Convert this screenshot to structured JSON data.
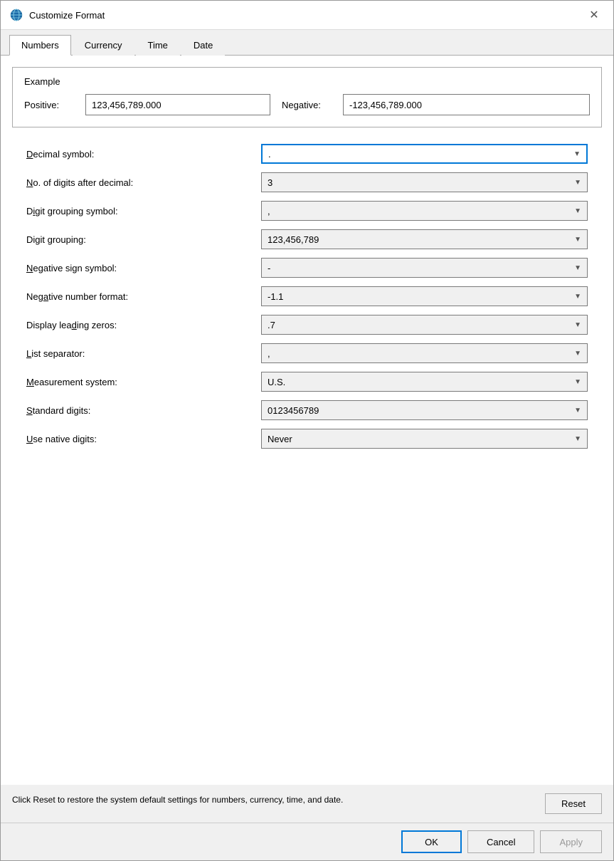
{
  "dialog": {
    "title": "Customize Format",
    "icon": "globe-icon"
  },
  "tabs": [
    {
      "id": "numbers",
      "label": "Numbers",
      "active": true
    },
    {
      "id": "currency",
      "label": "Currency",
      "active": false
    },
    {
      "id": "time",
      "label": "Time",
      "active": false
    },
    {
      "id": "date",
      "label": "Date",
      "active": false
    }
  ],
  "example": {
    "title": "Example",
    "positive_label": "Positive:",
    "positive_value": "123,456,789.000",
    "negative_label": "Negative:",
    "negative_value": "-123,456,789.000"
  },
  "settings": [
    {
      "id": "decimal-symbol",
      "label_html": "<u>D</u>ecimal symbol:",
      "label_text": "Decimal symbol:",
      "value": ".",
      "active": true
    },
    {
      "id": "digits-after-decimal",
      "label_html": "<u>N</u>o. of digits after decimal:",
      "label_text": "No. of digits after decimal:",
      "value": "3",
      "active": false
    },
    {
      "id": "digit-grouping-symbol",
      "label_html": "D<u>i</u>git grouping symbol:",
      "label_text": "Digit grouping symbol:",
      "value": ",",
      "active": false
    },
    {
      "id": "digit-grouping",
      "label_html": "Di<u>g</u>it grouping:",
      "label_text": "Digit grouping:",
      "value": "123,456,789",
      "active": false
    },
    {
      "id": "negative-sign-symbol",
      "label_html": "<u>N</u>egative sign symbol:",
      "label_text": "Negative sign symbol:",
      "value": "-",
      "active": false
    },
    {
      "id": "negative-number-format",
      "label_html": "Neg<u>a</u>tive number format:",
      "label_text": "Negative number format:",
      "value": "-1.1",
      "active": false
    },
    {
      "id": "display-leading-zeros",
      "label_html": "Display lea<u>d</u>ing zeros:",
      "label_text": "Display leading zeros:",
      "value": ".7",
      "active": false
    },
    {
      "id": "list-separator",
      "label_html": "<u>L</u>ist separator:",
      "label_text": "List separator:",
      "value": ",",
      "active": false
    },
    {
      "id": "measurement-system",
      "label_html": "<u>M</u>easurement system:",
      "label_text": "Measurement system:",
      "value": "U.S.",
      "active": false
    },
    {
      "id": "standard-digits",
      "label_html": "<u>S</u>tandard digits:",
      "label_text": "Standard digits:",
      "value": "0123456789",
      "active": false
    },
    {
      "id": "use-native-digits",
      "label_html": "<u>U</u>se native digits:",
      "label_text": "Use native digits:",
      "value": "Never",
      "active": false
    }
  ],
  "footer": {
    "text": "Click Reset to restore the system default settings for numbers, currency, time, and date.",
    "reset_label": "Reset"
  },
  "buttons": {
    "ok": "OK",
    "cancel": "Cancel",
    "apply": "Apply"
  }
}
